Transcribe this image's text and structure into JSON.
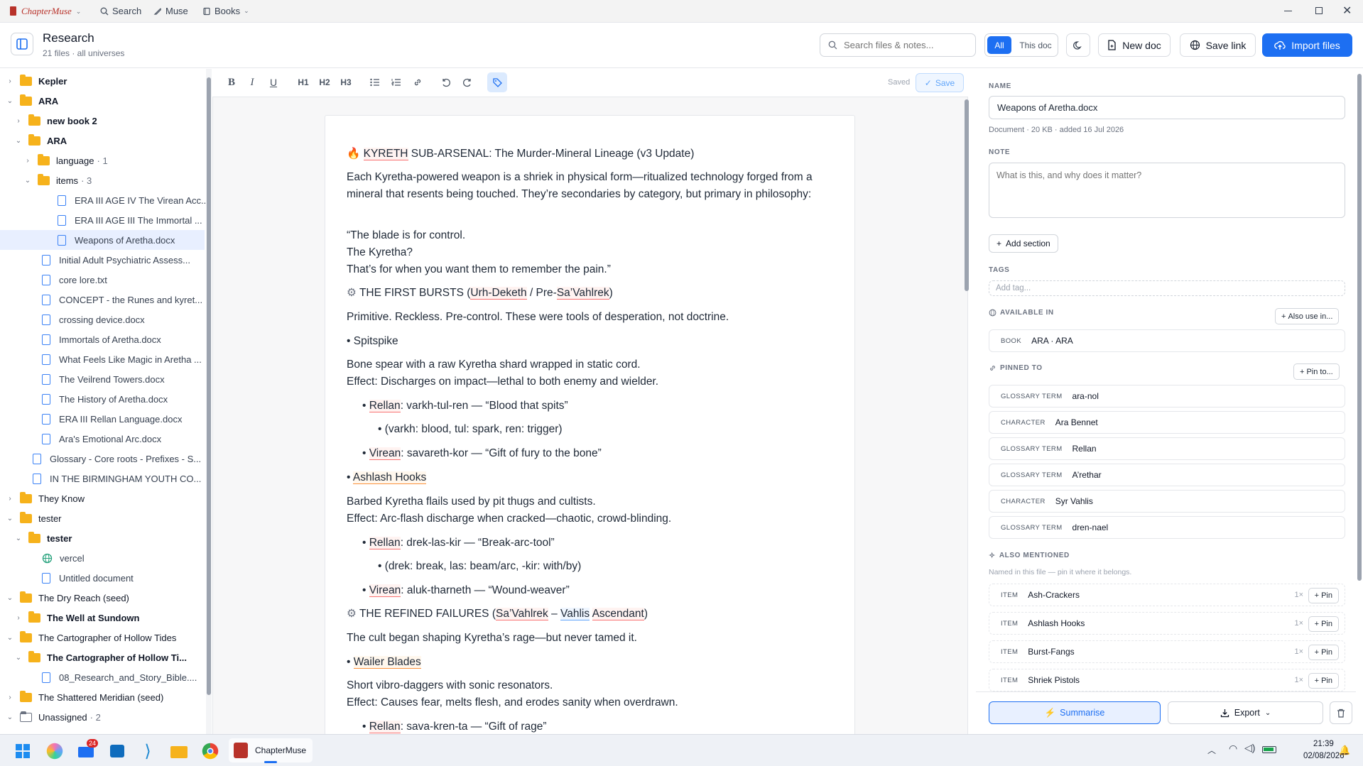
{
  "titlebar": {
    "app_name": "ChapterMuse",
    "nav": [
      {
        "label": "Search"
      },
      {
        "label": "Muse"
      },
      {
        "label": "Books"
      }
    ]
  },
  "header": {
    "title": "Research",
    "subtitle": "21 files · all universes",
    "search_placeholder": "Search files & notes...",
    "scope_all": "All",
    "scope_doc": "This doc",
    "new_doc": "New doc",
    "save_link": "Save link",
    "import_files": "Import files"
  },
  "tree": [
    {
      "label": "Kepler",
      "type": "folder",
      "level": 0,
      "chev": "›",
      "bold": true
    },
    {
      "label": "ARA",
      "type": "folder",
      "level": 0,
      "chev": "⌄",
      "bold": true
    },
    {
      "label": "new book 2",
      "type": "folder",
      "level": 1,
      "chev": "›",
      "bold": true
    },
    {
      "label": "ARA",
      "type": "folder",
      "level": 1,
      "chev": "⌄",
      "bold": true
    },
    {
      "label": "language",
      "type": "folder",
      "level": 2,
      "chev": "›",
      "count": "· 1"
    },
    {
      "label": "items",
      "type": "folder",
      "level": 2,
      "chev": "⌄",
      "count": "· 3"
    },
    {
      "label": "ERA III AGE IV The Virean Acc...",
      "type": "doc",
      "level": 3
    },
    {
      "label": "ERA III AGE III The Immortal ...",
      "type": "doc",
      "level": 3
    },
    {
      "label": "Weapons of Aretha.docx",
      "type": "doc",
      "level": 3,
      "selected": true
    },
    {
      "label": "Initial Adult Psychiatric Assess...",
      "type": "doc",
      "level": 2
    },
    {
      "label": "core lore.txt",
      "type": "doc",
      "level": 2
    },
    {
      "label": "CONCEPT - the Runes and kyret...",
      "type": "doc",
      "level": 2
    },
    {
      "label": "crossing device.docx",
      "type": "doc",
      "level": 2
    },
    {
      "label": "Immortals of Aretha.docx",
      "type": "doc",
      "level": 2
    },
    {
      "label": "What Feels Like Magic in Aretha ...",
      "type": "doc",
      "level": 2
    },
    {
      "label": "The Veilrend Towers.docx",
      "type": "doc",
      "level": 2
    },
    {
      "label": "The History of Aretha.docx",
      "type": "doc",
      "level": 2
    },
    {
      "label": "ERA III Rellan Language.docx",
      "type": "doc",
      "level": 2
    },
    {
      "label": "Ara's Emotional Arc.docx",
      "type": "doc",
      "level": 2
    },
    {
      "label": "Glossary - Core roots - Prefixes - S...",
      "type": "doc",
      "level": 1
    },
    {
      "label": "IN THE BIRMINGHAM YOUTH CO...",
      "type": "doc",
      "level": 1
    },
    {
      "label": "They Know",
      "type": "folder",
      "level": 0,
      "chev": "›"
    },
    {
      "label": "tester",
      "type": "folder",
      "level": 0,
      "chev": "⌄"
    },
    {
      "label": "tester",
      "type": "folder",
      "level": 1,
      "chev": "⌄",
      "bold": true
    },
    {
      "label": "vercel",
      "type": "globe",
      "level": 2
    },
    {
      "label": "Untitled document",
      "type": "doc",
      "level": 2
    },
    {
      "label": "The Dry Reach (seed)",
      "type": "folder",
      "level": 0,
      "chev": "⌄"
    },
    {
      "label": "The Well at Sundown",
      "type": "folder",
      "level": 1,
      "chev": "›",
      "bold": true
    },
    {
      "label": "The Cartographer of Hollow Tides",
      "type": "folder",
      "level": 0,
      "chev": "⌄"
    },
    {
      "label": "The Cartographer of Hollow Ti...",
      "type": "folder",
      "level": 1,
      "chev": "⌄",
      "bold": true
    },
    {
      "label": "08_Research_and_Story_Bible....",
      "type": "doc",
      "level": 2
    },
    {
      "label": "The Shattered Meridian (seed)",
      "type": "folder",
      "level": 0,
      "chev": "›"
    },
    {
      "label": "Unassigned",
      "type": "empty",
      "level": 0,
      "chev": "⌄",
      "count": "· 2"
    }
  ],
  "toolbar": {
    "h1": "H1",
    "h2": "H2",
    "h3": "H3",
    "status": "Saved",
    "save": "Save"
  },
  "document": {
    "heading_term": "KYRETH",
    "heading_rest": " SUB-ARSENAL: The Murder-Mineral Lineage (v3 Update)",
    "intro": "Each Kyretha-powered weapon is a shriek in physical form—ritualized technology forged from a mineral that resents being touched. They’re secondaries by category, but primary in philosophy:",
    "quote_1": "“The blade is for control.",
    "quote_2": "The Kyretha?",
    "quote_3": "That’s for when you want them to remember the pain.”",
    "s1_pre": "THE FIRST BURSTS (",
    "s1_t1": "Urh-Deketh",
    "s1_mid": " / Pre-",
    "s1_t2": "Sa’Vahlrek",
    "s1_end": ")",
    "s1_desc": "Primitive. Reckless. Pre-control. These were tools of desperation, not doctrine.",
    "w1_name": "• Spitspike",
    "w1_d1": "Bone spear with a raw Kyretha shard wrapped in static cord.",
    "w1_d2": "Effect: Discharges on impact—lethal to both enemy and wielder.",
    "w1_r_term": "Rellan",
    "w1_r": ": varkh-tul-ren — “Blood that spits”",
    "w1_r_sub": "(varkh: blood, tul: spark, ren: trigger)",
    "w1_v_term": "Virean",
    "w1_v": ": savareth-kor — “Gift of fury to the bone”",
    "w2_bullet": "• ",
    "w2_name": "Ashlash Hooks",
    "w2_d1": "Barbed Kyretha flails used by pit thugs and cultists.",
    "w2_d2": "Effect: Arc-flash discharge when cracked—chaotic, crowd-blinding.",
    "w2_r_term": "Rellan",
    "w2_r": ": drek-las-kir — “Break-arc-tool”",
    "w2_r_sub": "(drek: break, las: beam/arc, -kir: with/by)",
    "w2_v_term": "Virean",
    "w2_v": ": aluk-tharneth — “Wound-weaver”",
    "s2_pre": "THE REFINED FAILURES (",
    "s2_t1": "Sa’Vahlrek",
    "s2_mid": " – ",
    "s2_t2": "Vahlis",
    "s2_sp": " ",
    "s2_t3": "Ascendant",
    "s2_end": ")",
    "s2_desc": "The cult began shaping Kyretha’s rage—but never tamed it.",
    "w3_bullet": "• ",
    "w3_name": "Wailer Blades",
    "w3_d1": "Short vibro-daggers with sonic resonators.",
    "w3_d2": "Effect: Causes fear, melts flesh, and erodes sanity when overdrawn.",
    "w3_r_term": "Rellan",
    "w3_r": ": sava-kren-ta — “Gift of rage”"
  },
  "details": {
    "name_label": "NAME",
    "name_value": "Weapons of Aretha.docx",
    "meta": "Document · 20 KB · added 16 Jul 2026",
    "note_label": "NOTE",
    "note_placeholder": "What is this, and why does it matter?",
    "add_section": "Add section",
    "tags_label": "TAGS",
    "tag_placeholder": "Add tag...",
    "available_label": "AVAILABLE IN",
    "also_use": "Also use in...",
    "book_kind": "BOOK",
    "book_value": "ARA · ARA",
    "pinned_label": "PINNED TO",
    "pin_to": "Pin to...",
    "pinned": [
      {
        "kind": "GLOSSARY TERM",
        "value": "ara-nol"
      },
      {
        "kind": "CHARACTER",
        "value": "Ara Bennet"
      },
      {
        "kind": "GLOSSARY TERM",
        "value": "Rellan"
      },
      {
        "kind": "GLOSSARY TERM",
        "value": "A’rethar"
      },
      {
        "kind": "CHARACTER",
        "value": "Syr Vahlis"
      },
      {
        "kind": "GLOSSARY TERM",
        "value": "dren-nael"
      }
    ],
    "mentioned_label": "ALSO MENTIONED",
    "mentioned_hint": "Named in this file — pin it where it belongs.",
    "mentioned": [
      {
        "kind": "ITEM",
        "value": "Ash-Crackers",
        "count": "1×",
        "action": "Pin"
      },
      {
        "kind": "ITEM",
        "value": "Ashlash Hooks",
        "count": "1×",
        "action": "Pin"
      },
      {
        "kind": "ITEM",
        "value": "Burst-Fangs",
        "count": "1×",
        "action": "Pin"
      },
      {
        "kind": "ITEM",
        "value": "Shriek Pistols",
        "count": "1×",
        "action": "Pin"
      }
    ],
    "summarise": "Summarise",
    "export": "Export"
  },
  "taskbar": {
    "mail_badge": "24",
    "active_app": "ChapterMuse",
    "time": "21:39",
    "date": "02/08/2026"
  },
  "colors": {
    "accent": "#1d6ff2",
    "folder": "#f6b21b",
    "brand": "#b8322a"
  }
}
